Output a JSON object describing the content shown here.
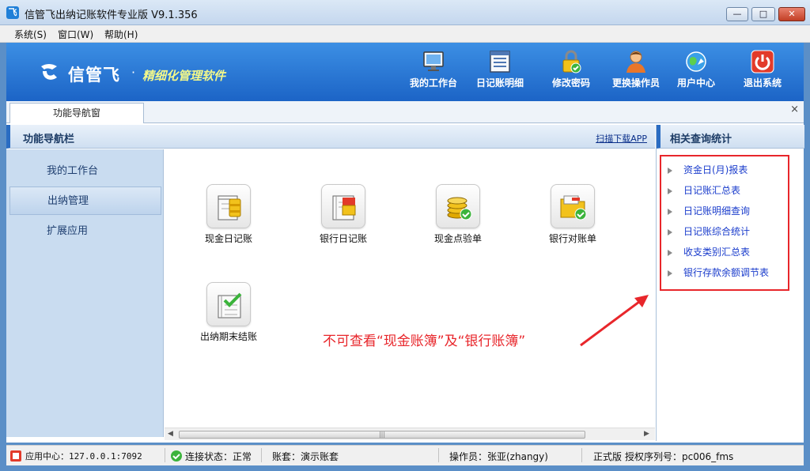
{
  "window": {
    "title": "信管飞出纳记账软件专业版 V9.1.356",
    "buttons": {
      "minimize": "—",
      "maximize": "□",
      "close": "✕"
    }
  },
  "menu": [
    "系统(S)",
    "窗口(W)",
    "帮助(H)"
  ],
  "banner": {
    "brand": "信管飞",
    "dot": "·",
    "slogan": "精细化管理软件",
    "tools": [
      {
        "label": "我的工作台",
        "icon": "monitor-icon"
      },
      {
        "label": "日记账明细",
        "icon": "ledger-icon"
      },
      {
        "label": "修改密码",
        "icon": "lock-icon"
      },
      {
        "label": "更换操作员",
        "icon": "user-icon"
      },
      {
        "label": "用户中心",
        "icon": "globe-icon"
      },
      {
        "label": "退出系统",
        "icon": "power-icon"
      }
    ]
  },
  "tab": {
    "label": "功能导航窗",
    "close": "×"
  },
  "nav": {
    "title": "功能导航栏",
    "scan_link": "扫描下载APP",
    "items": [
      "我的工作台",
      "出纳管理",
      "扩展应用"
    ],
    "active_index": 1
  },
  "functions": [
    {
      "label": "现金日记账",
      "icon": "cash-journal-icon"
    },
    {
      "label": "银行日记账",
      "icon": "bank-journal-icon"
    },
    {
      "label": "现金点验单",
      "icon": "coin-check-icon"
    },
    {
      "label": "银行对账单",
      "icon": "folder-check-icon"
    },
    {
      "label": "出纳期末结账",
      "icon": "notebook-check-icon"
    }
  ],
  "annotation": "不可查看“现金账簿”及“银行账簿”",
  "right_panel": {
    "title": "相关查询统计",
    "items": [
      "资金日(月)报表",
      "日记账汇总表",
      "日记账明细查询",
      "日记账综合统计",
      "收支类别汇总表",
      "银行存款余额调节表"
    ]
  },
  "scrollbar": {
    "left": "◀",
    "right": "▶",
    "grip": "|||"
  },
  "status": {
    "app_center": "应用中心：127.0.0.1:7092",
    "connection": "连接状态：正常",
    "account_set": "账套：演示账套",
    "operator": "操作员：张亚(zhangy)",
    "edition": "正式版",
    "serial": "授权序列号：pc006_fms"
  },
  "colors": {
    "banner": "#2a78d8",
    "annotation_red": "#e8262b",
    "link_blue": "#1a3ccc",
    "slogan_yellow": "#f3f88a"
  }
}
